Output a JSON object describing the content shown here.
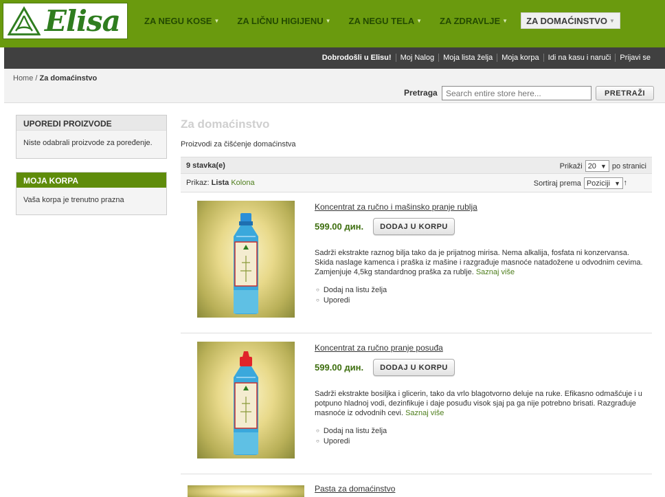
{
  "brand": {
    "name": "Elisa"
  },
  "nav": [
    {
      "label": "ZA NEGU KOSE"
    },
    {
      "label": "ZA LIČNU HIGIJENU"
    },
    {
      "label": "ZA NEGU TELA"
    },
    {
      "label": "ZA ZDRAVLJE"
    },
    {
      "label": "ZA DOMAĆINSTVO",
      "active": true
    }
  ],
  "account": {
    "welcome": "Dobrodošli u Elisu!",
    "links": [
      "Moj Nalog",
      "Moja lista želja",
      "Moja korpa",
      "Idi na kasu i naruči",
      "Prijavi se"
    ]
  },
  "breadcrumb": {
    "home": "Home",
    "separator": " / ",
    "current": "Za domaćinstvo"
  },
  "search": {
    "label": "Pretraga",
    "placeholder": "Search entire store here...",
    "button": "PRETRAŽI"
  },
  "sidebar": {
    "compare": {
      "title": "UPOREDI PROIZVODE",
      "text": "Niste odabrali proizvode za poređenje."
    },
    "cart": {
      "title": "MOJA KORPA",
      "text": "Vaša korpa je trenutno prazna"
    }
  },
  "category": {
    "title": "Za domaćinstvo",
    "description": "Proizvodi za čišćenje domaćinstva"
  },
  "toolbar": {
    "count": "9 stavka(e)",
    "show_label": "Prikaži",
    "show_value": "20",
    "per_page": "po stranici",
    "view_label": "Prikaz:",
    "view_list": "Lista",
    "view_grid": "Kolona",
    "sort_label": "Sortiraj prema",
    "sort_value": "Poziciji",
    "sort_dir": "↑"
  },
  "products": [
    {
      "name": "Koncentrat za ručno i mašinsko pranje rublja",
      "price": "599.00 дин.",
      "button": "DODAJ U KORPU",
      "description": "Sadrži ekstrakte raznog bilja tako da je prijatnog mirisa. Nema alkalija, fosfata ni konzervansa. Skida naslage kamenca i praška iz mašine i razgrađuje masnoće natadožene u odvodnim cevima. Zamjenjuje 4,5kg standardnog praška za rublje.",
      "more": "Saznaj više",
      "wishlist": "Dodaj na listu želja",
      "compare": "Uporedi",
      "cap_color": "#2a8fd8"
    },
    {
      "name": "Koncentrat za ručno pranje posuđa",
      "price": "599.00 дин.",
      "button": "DODAJ U KORPU",
      "description": "Sadrži ekstrakte bosiljka i glicerin, tako da vrlo blagotvorno deluje na ruke. Efikasno odmašćuje i u potpuno hladnoj vodi, dezinfikuje i daje posuđu visok sjaj pa ga nije potrebno brisati. Razgrađuje masnoće iz odvodnih cevi.",
      "more": "Saznaj više",
      "wishlist": "Dodaj na listu želja",
      "compare": "Uporedi",
      "cap_color": "#e0242a"
    },
    {
      "name": "Pasta za domaćinstvo"
    }
  ]
}
